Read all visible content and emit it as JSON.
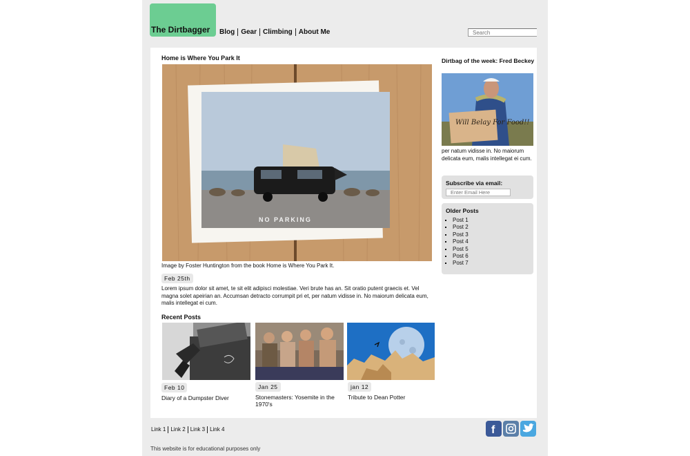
{
  "header": {
    "logo_text": "The Dirtbagger",
    "nav": [
      "Blog",
      "Gear",
      "Climbing",
      "About Me"
    ],
    "search_placeholder": "Search"
  },
  "post": {
    "title": "Home is Where You Park It",
    "caption": "Image by Foster Huntington from the book Home is Where You Park It.",
    "date": "Feb 25th",
    "body": "Lorem ipsum dolor sit amet, te sit elit adipisci molestiae. Veri brute has an. Sit oratio putent graecis et. Vel magna solet apeirian an. Accumsan detracto corrumpit pri et, per natum vidisse in. No maiorum delicata eum, malis intellegat ei cum."
  },
  "recent": {
    "heading": "Recent Posts",
    "items": [
      {
        "date": "Feb 10",
        "title": "Diary of a Dumpster Diver"
      },
      {
        "date": "Jan 25",
        "title": "Stonemasters: Yosemite in the 1970's"
      },
      {
        "date": "jan 12",
        "title": "Tribute to Dean Potter"
      }
    ]
  },
  "sidebar": {
    "dirtbag_title": "Dirtbag of the week: Fred Beckey",
    "sign_text": "Will Belay For Food!!",
    "dirtbag_text": "per natum vidisse in. No maiorum delicata eum, malis intellegat ei cum.",
    "subscribe_title": "Subscribe via email:",
    "email_placeholder": "Enter Email Here",
    "older_title": "Older Posts",
    "older_posts": [
      "Post 1",
      "Post 2",
      "Post 3",
      "Post 4",
      "Post 5",
      "Post 6",
      "Post 7"
    ]
  },
  "hero_image": {
    "sign_text": "NO PARKING"
  },
  "footer": {
    "links": [
      "Link 1",
      "Link 2",
      "Link 3",
      "Link 4"
    ],
    "note": "This website is for educational purposes only",
    "social_icons": [
      "facebook-icon",
      "instagram-icon",
      "twitter-icon"
    ]
  },
  "colors": {
    "logo_bg": "#6ccd92",
    "page_bg": "#ececec",
    "facebook": "#3b5998",
    "instagram": "#5b7fa8",
    "twitter": "#4aa7e0"
  }
}
